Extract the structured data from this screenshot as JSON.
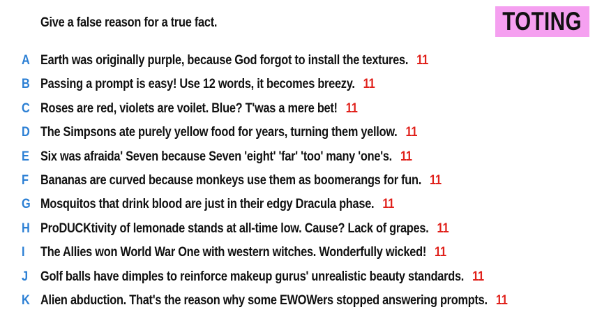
{
  "prompt": "Give a false reason for a true fact.",
  "badge": {
    "label": "TOTING",
    "color": "#f5a0f0"
  },
  "colors": {
    "letter": "#2b7fd4",
    "count": "#e0201a"
  },
  "responses": [
    {
      "letter": "A",
      "text": "Earth was originally purple, because God forgot to install the textures.",
      "count": "11"
    },
    {
      "letter": "B",
      "text": "Passing a prompt is easy! Use 12 words, it becomes breezy.",
      "count": "11"
    },
    {
      "letter": "C",
      "text": "Roses are red, violets are voilet. Blue? T'was a mere bet!",
      "count": "11"
    },
    {
      "letter": "D",
      "text": "The Simpsons ate purely yellow food for years, turning them yellow.",
      "count": "11"
    },
    {
      "letter": "E",
      "text": "Six was afraida' Seven because Seven 'eight' 'far' 'too' many 'one's.",
      "count": "11"
    },
    {
      "letter": "F",
      "text": "Bananas are curved because monkeys use them as boomerangs for fun.",
      "count": "11"
    },
    {
      "letter": "G",
      "text": "Mosquitos that drink blood are just in their edgy Dracula phase.",
      "count": "11"
    },
    {
      "letter": "H",
      "text": "ProDUCKtivity of lemonade stands at all-time low. Cause? Lack of grapes.",
      "count": "11"
    },
    {
      "letter": "I",
      "text": "The Allies won World War One with western witches. Wonderfully wicked!",
      "count": "11"
    },
    {
      "letter": "J",
      "text": "Golf balls have dimples to reinforce makeup gurus' unrealistic beauty standards.",
      "count": "11"
    },
    {
      "letter": "K",
      "text": "Alien abduction. That's the reason why some EWOWers stopped answering prompts.",
      "count": "11"
    }
  ]
}
